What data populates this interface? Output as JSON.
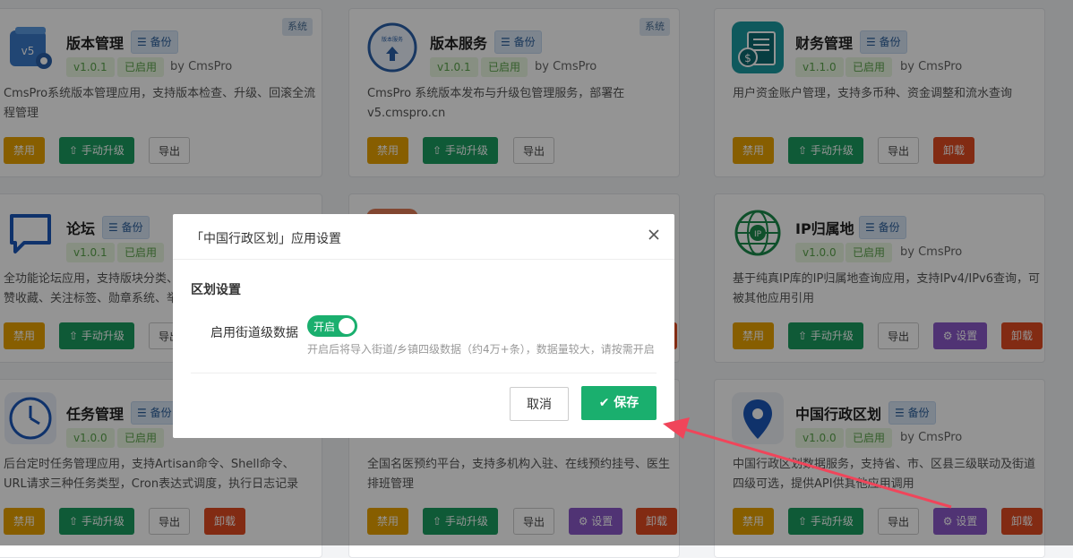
{
  "backup_label": "备份",
  "system_label": "系统",
  "author": "by CmsPro",
  "enabled": "已启用",
  "buttons": {
    "disable": "禁用",
    "upgrade": "手动升级",
    "export": "导出",
    "uninstall": "卸载",
    "settings": "设置"
  },
  "cards": [
    {
      "title": "版本管理",
      "version": "v1.0.1",
      "desc": "CmsPro系统版本管理应用，支持版本检查、升级、回滚全流程管理"
    },
    {
      "title": "版本服务",
      "version": "v1.0.1",
      "desc": "CmsPro 系统版本发布与升级包管理服务，部署在v5.cmspro.cn"
    },
    {
      "title": "财务管理",
      "version": "v1.1.0",
      "desc": "用户资金账户管理，支持多币种、资金调整和流水查询"
    },
    {
      "title": "论坛",
      "version": "v1.0.1",
      "desc": "全功能论坛应用，支持版块分类、赞收藏、关注标签、勋章系统、举"
    },
    {
      "title": "IP归属地",
      "version": "v1.0.0",
      "desc": "基于纯真IP库的IP归属地查询应用，支持IPv4/IPv6查询，可被其他应用引用"
    },
    {
      "title": "任务管理",
      "version": "v1.0.0",
      "desc": "后台定时任务管理应用，支持Artisan命令、Shell命令、URL请求三种任务类型，Cron表达式调度，执行日志记录"
    },
    {
      "desc": "全国名医预约平台，支持多机构入驻、在线预约挂号、医生排班管理"
    },
    {
      "title": "中国行政区划",
      "version": "v1.0.0",
      "desc": "中国行政区划数据服务，支持省、市、区县三级联动及街道四级可选，提供API供其他应用调用"
    }
  ],
  "icon_text": {
    "v5": "v5",
    "ver_service": "版本服务",
    "ip": "IP"
  },
  "modal": {
    "title": "「中国行政区划」应用设置",
    "section": "区划设置",
    "field_label": "启用街道级数据",
    "toggle_label": "开启",
    "hint": "开启后将导入街道/乡镇四级数据（约4万+条），数据量较大，请按需开启",
    "cancel": "取消",
    "save": "保存"
  },
  "colors": {
    "primary": "#1aaf6e",
    "warning": "#e8a200",
    "danger": "#e04b22",
    "purple": "#8a58c9",
    "arrow": "#f0455a"
  }
}
